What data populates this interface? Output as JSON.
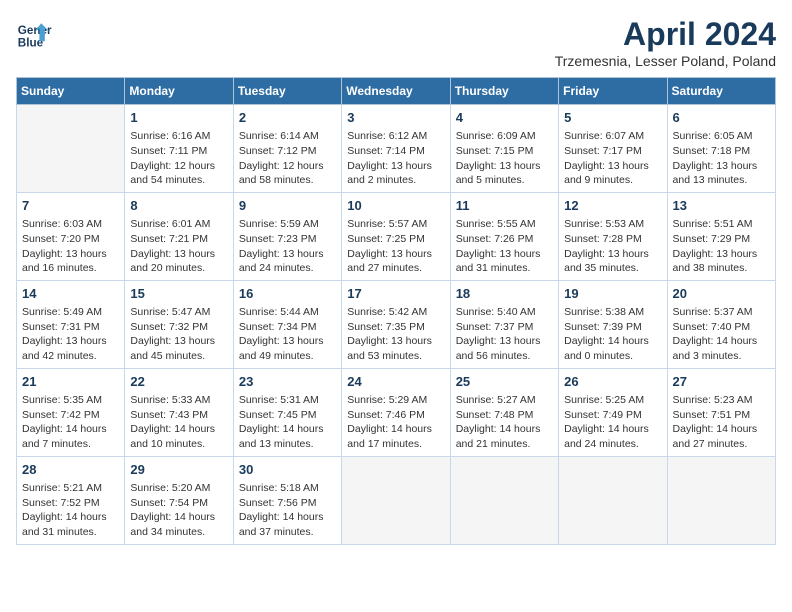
{
  "logo": {
    "line1": "General",
    "line2": "Blue"
  },
  "title": "April 2024",
  "subtitle": "Trzemesnia, Lesser Poland, Poland",
  "days_header": [
    "Sunday",
    "Monday",
    "Tuesday",
    "Wednesday",
    "Thursday",
    "Friday",
    "Saturday"
  ],
  "weeks": [
    [
      {
        "day": "",
        "info": ""
      },
      {
        "day": "1",
        "info": "Sunrise: 6:16 AM\nSunset: 7:11 PM\nDaylight: 12 hours\nand 54 minutes."
      },
      {
        "day": "2",
        "info": "Sunrise: 6:14 AM\nSunset: 7:12 PM\nDaylight: 12 hours\nand 58 minutes."
      },
      {
        "day": "3",
        "info": "Sunrise: 6:12 AM\nSunset: 7:14 PM\nDaylight: 13 hours\nand 2 minutes."
      },
      {
        "day": "4",
        "info": "Sunrise: 6:09 AM\nSunset: 7:15 PM\nDaylight: 13 hours\nand 5 minutes."
      },
      {
        "day": "5",
        "info": "Sunrise: 6:07 AM\nSunset: 7:17 PM\nDaylight: 13 hours\nand 9 minutes."
      },
      {
        "day": "6",
        "info": "Sunrise: 6:05 AM\nSunset: 7:18 PM\nDaylight: 13 hours\nand 13 minutes."
      }
    ],
    [
      {
        "day": "7",
        "info": "Sunrise: 6:03 AM\nSunset: 7:20 PM\nDaylight: 13 hours\nand 16 minutes."
      },
      {
        "day": "8",
        "info": "Sunrise: 6:01 AM\nSunset: 7:21 PM\nDaylight: 13 hours\nand 20 minutes."
      },
      {
        "day": "9",
        "info": "Sunrise: 5:59 AM\nSunset: 7:23 PM\nDaylight: 13 hours\nand 24 minutes."
      },
      {
        "day": "10",
        "info": "Sunrise: 5:57 AM\nSunset: 7:25 PM\nDaylight: 13 hours\nand 27 minutes."
      },
      {
        "day": "11",
        "info": "Sunrise: 5:55 AM\nSunset: 7:26 PM\nDaylight: 13 hours\nand 31 minutes."
      },
      {
        "day": "12",
        "info": "Sunrise: 5:53 AM\nSunset: 7:28 PM\nDaylight: 13 hours\nand 35 minutes."
      },
      {
        "day": "13",
        "info": "Sunrise: 5:51 AM\nSunset: 7:29 PM\nDaylight: 13 hours\nand 38 minutes."
      }
    ],
    [
      {
        "day": "14",
        "info": "Sunrise: 5:49 AM\nSunset: 7:31 PM\nDaylight: 13 hours\nand 42 minutes."
      },
      {
        "day": "15",
        "info": "Sunrise: 5:47 AM\nSunset: 7:32 PM\nDaylight: 13 hours\nand 45 minutes."
      },
      {
        "day": "16",
        "info": "Sunrise: 5:44 AM\nSunset: 7:34 PM\nDaylight: 13 hours\nand 49 minutes."
      },
      {
        "day": "17",
        "info": "Sunrise: 5:42 AM\nSunset: 7:35 PM\nDaylight: 13 hours\nand 53 minutes."
      },
      {
        "day": "18",
        "info": "Sunrise: 5:40 AM\nSunset: 7:37 PM\nDaylight: 13 hours\nand 56 minutes."
      },
      {
        "day": "19",
        "info": "Sunrise: 5:38 AM\nSunset: 7:39 PM\nDaylight: 14 hours\nand 0 minutes."
      },
      {
        "day": "20",
        "info": "Sunrise: 5:37 AM\nSunset: 7:40 PM\nDaylight: 14 hours\nand 3 minutes."
      }
    ],
    [
      {
        "day": "21",
        "info": "Sunrise: 5:35 AM\nSunset: 7:42 PM\nDaylight: 14 hours\nand 7 minutes."
      },
      {
        "day": "22",
        "info": "Sunrise: 5:33 AM\nSunset: 7:43 PM\nDaylight: 14 hours\nand 10 minutes."
      },
      {
        "day": "23",
        "info": "Sunrise: 5:31 AM\nSunset: 7:45 PM\nDaylight: 14 hours\nand 13 minutes."
      },
      {
        "day": "24",
        "info": "Sunrise: 5:29 AM\nSunset: 7:46 PM\nDaylight: 14 hours\nand 17 minutes."
      },
      {
        "day": "25",
        "info": "Sunrise: 5:27 AM\nSunset: 7:48 PM\nDaylight: 14 hours\nand 21 minutes."
      },
      {
        "day": "26",
        "info": "Sunrise: 5:25 AM\nSunset: 7:49 PM\nDaylight: 14 hours\nand 24 minutes."
      },
      {
        "day": "27",
        "info": "Sunrise: 5:23 AM\nSunset: 7:51 PM\nDaylight: 14 hours\nand 27 minutes."
      }
    ],
    [
      {
        "day": "28",
        "info": "Sunrise: 5:21 AM\nSunset: 7:52 PM\nDaylight: 14 hours\nand 31 minutes."
      },
      {
        "day": "29",
        "info": "Sunrise: 5:20 AM\nSunset: 7:54 PM\nDaylight: 14 hours\nand 34 minutes."
      },
      {
        "day": "30",
        "info": "Sunrise: 5:18 AM\nSunset: 7:56 PM\nDaylight: 14 hours\nand 37 minutes."
      },
      {
        "day": "",
        "info": ""
      },
      {
        "day": "",
        "info": ""
      },
      {
        "day": "",
        "info": ""
      },
      {
        "day": "",
        "info": ""
      }
    ]
  ]
}
